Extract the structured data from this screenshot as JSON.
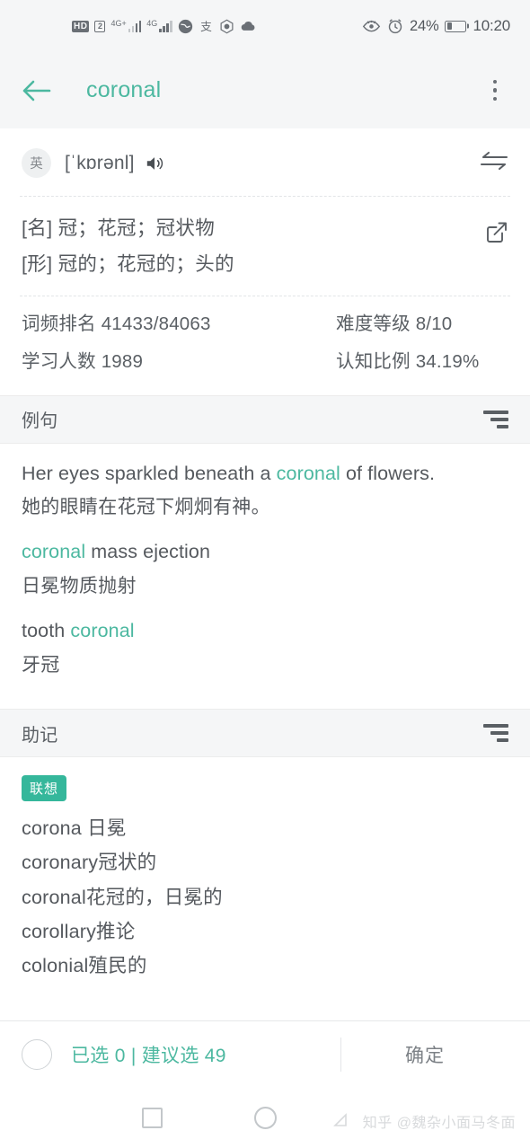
{
  "statusbar": {
    "hd_label": "HD",
    "sim_label": "2",
    "net1_label": "4G+",
    "net2_label": "4G",
    "icons": [
      "globe-icon",
      "alipay-icon",
      "hexagon-icon",
      "cloud-icon"
    ],
    "eye_icon": "eye-icon",
    "alarm_icon": "alarm-icon",
    "battery_percent": "24%",
    "time": "10:20"
  },
  "appbar": {
    "back_icon": "back-arrow-icon",
    "title": "coronal",
    "menu_icon": "kebab-menu-icon"
  },
  "pronunciation": {
    "lang_badge": "英",
    "phonetic": "[ˈkɒrənl]",
    "speaker_icon": "speaker-icon",
    "swap_icon": "swap-icon"
  },
  "definitions": {
    "lines": [
      "[名] 冠；花冠；冠状物",
      "[形] 冠的；花冠的；头的"
    ],
    "edit_icon": "edit-icon"
  },
  "stats": {
    "rows": [
      {
        "left": "词频排名 41433/84063",
        "right": "难度等级 8/10"
      },
      {
        "left": "学习人数 1989",
        "right": "认知比例 34.19%"
      }
    ]
  },
  "examples_section": {
    "title": "例句",
    "sort_icon": "sort-icon",
    "items": [
      {
        "en_pre": "Her eyes sparkled beneath a ",
        "en_hl": "coronal",
        "en_post": " of flowers.",
        "zh": "她的眼睛在花冠下炯炯有神。"
      },
      {
        "en_pre": "",
        "en_hl": "coronal",
        "en_post": " mass ejection",
        "zh": "日冕物质抛射"
      },
      {
        "en_pre": "tooth ",
        "en_hl": "coronal",
        "en_post": "",
        "zh": "牙冠"
      }
    ]
  },
  "mnemonic_section": {
    "title": "助记",
    "sort_icon": "sort-icon",
    "tag": "联想",
    "lines": [
      "corona 日冕",
      "coronary冠状的",
      "coronal花冠的，日冕的",
      "corollary推论",
      "colonial殖民的"
    ]
  },
  "bottombar": {
    "checkbox_icon": "circle-checkbox-icon",
    "selection_text": "已选 0 | 建议选 49",
    "confirm_label": "确定"
  },
  "navbar": {
    "recents_icon": "square-recents-icon",
    "home_icon": "circle-home-icon",
    "watermark": "知乎 @魏杂小面马冬面"
  },
  "colors": {
    "accent": "#4cb8a0",
    "tag_bg": "#35b79b",
    "section_bg": "#f5f6f7",
    "text": "#55595e"
  }
}
